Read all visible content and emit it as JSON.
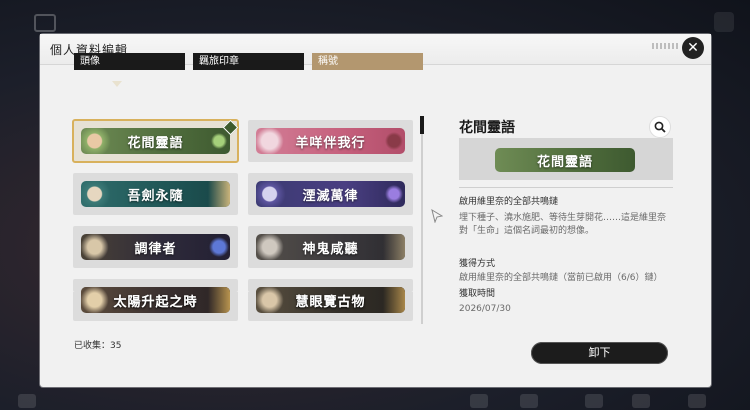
{
  "window": {
    "title": "個人資料編輯"
  },
  "tabs": [
    {
      "label": "頭像",
      "active": false
    },
    {
      "label": "羈旅印章",
      "active": false
    },
    {
      "label": "稱號",
      "active": true
    }
  ],
  "titles": [
    {
      "label": "花間靈語",
      "selected": true,
      "color": "#58784a"
    },
    {
      "label": "羊咩伴我行",
      "selected": false,
      "color": "#c55f7c"
    },
    {
      "label": "吾劍永隨",
      "selected": false,
      "color": "#2a6a6a"
    },
    {
      "label": "湮滅萬律",
      "selected": false,
      "color": "#4a3f82"
    },
    {
      "label": "調律者",
      "selected": false,
      "color": "#2e2a3a"
    },
    {
      "label": "神鬼咸聽",
      "selected": false,
      "color": "#3c3a3e"
    },
    {
      "label": "太陽升起之時",
      "selected": false,
      "color": "#3a3030"
    },
    {
      "label": "慧眼覽古物",
      "selected": false,
      "color": "#34302a"
    }
  ],
  "detail": {
    "name": "花間靈語",
    "banner_label": "花間靈語",
    "source_title": "啟用維里奈的全部共鳴鏈",
    "desc_line1": "埋下種子、澆水施肥、等待生芽開花……這是維里奈",
    "desc_line2": "對「生命」這個名詞最初的想像。",
    "acquire_heading": "獲得方式",
    "acquire_text": "啟用維里奈的全部共鳴鏈（當前已啟用（6/6）鏈）",
    "time_heading": "獲取時間",
    "time_value": "2026/07/30"
  },
  "footer": {
    "collected_label": "已收集：",
    "collected_count": "35",
    "unequip_label": "卸下"
  },
  "colors": {
    "accent_gold": "#b3976f",
    "selected_outline": "#d8b15c"
  }
}
